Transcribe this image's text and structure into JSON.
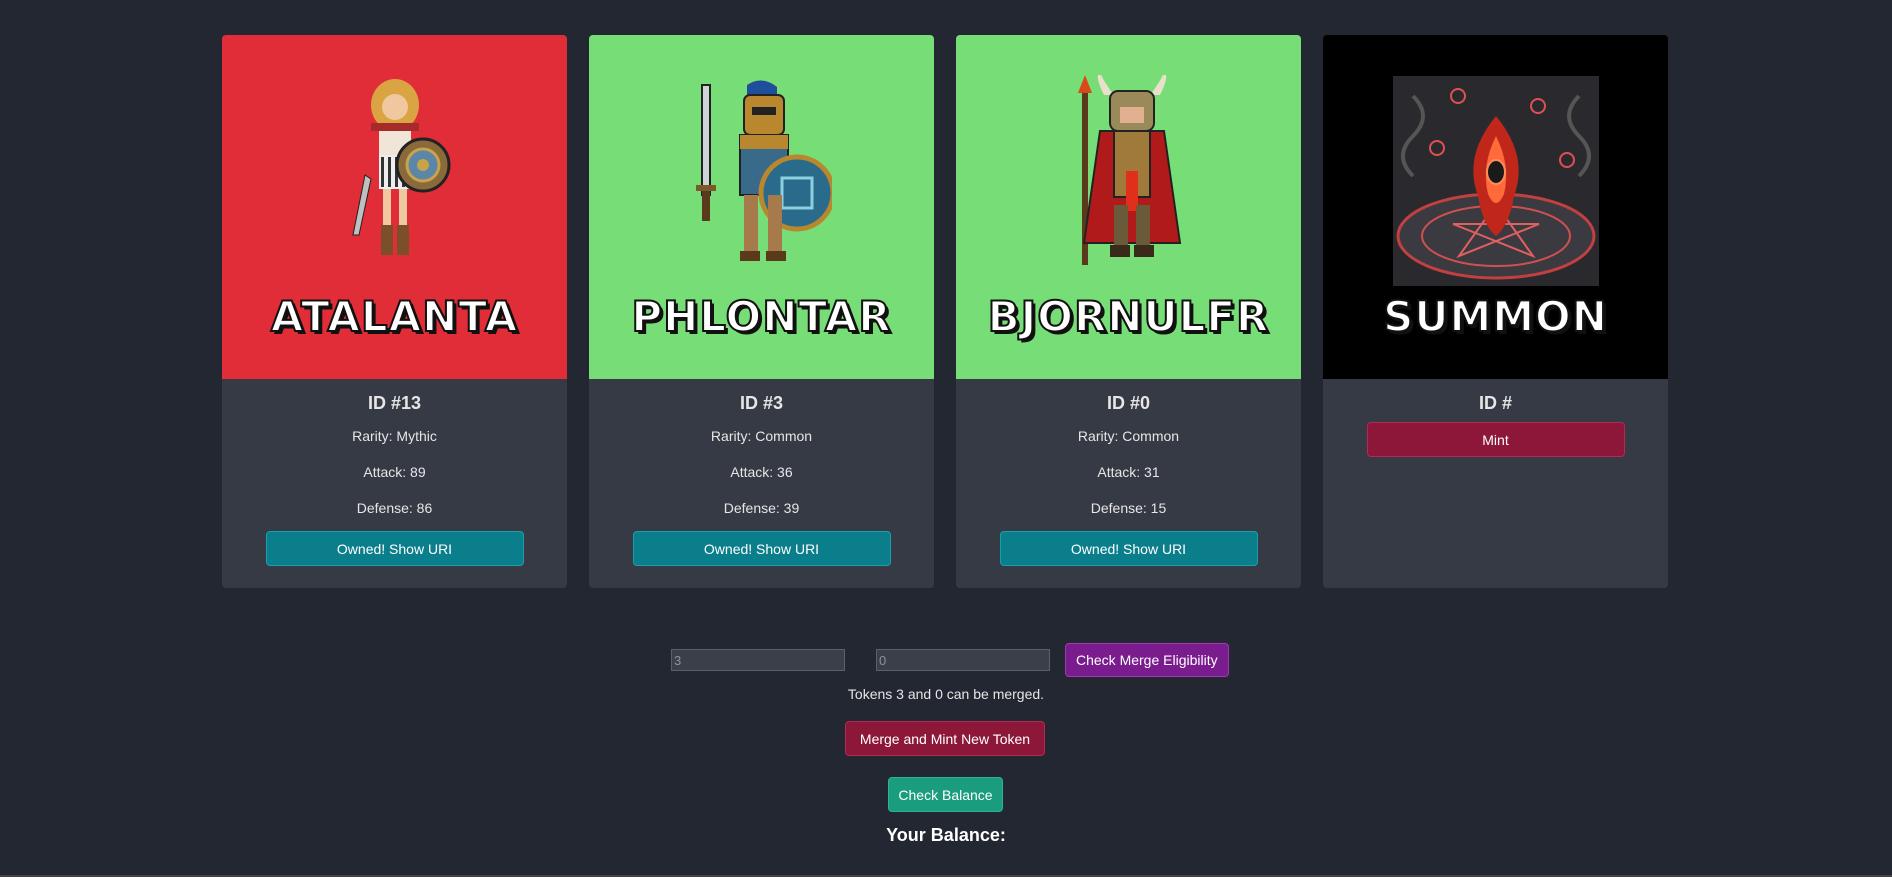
{
  "colors": {
    "background": "#222731",
    "card": "#363a44",
    "atalanta_bg": "#e02d38",
    "common_bg": "#77dd77",
    "summon_bg": "#000000",
    "owned_button": "#0a7e8b",
    "mint_button": "#8c1739",
    "merge_check_button": "#7a1b8e",
    "balance_button": "#1a9c7e"
  },
  "cards": [
    {
      "art_name": "ATALANTA",
      "id_text": "ID #13",
      "rarity": "Rarity: Mythic",
      "attack": "Attack: 89",
      "defense": "Defense: 86",
      "button": "Owned! Show URI"
    },
    {
      "art_name": "PHLONTAR",
      "id_text": "ID #3",
      "rarity": "Rarity: Common",
      "attack": "Attack: 36",
      "defense": "Defense: 39",
      "button": "Owned! Show URI"
    },
    {
      "art_name": "BJORNULFR",
      "id_text": "ID #0",
      "rarity": "Rarity: Common",
      "attack": "Attack: 31",
      "defense": "Defense: 15",
      "button": "Owned! Show URI"
    },
    {
      "art_name": "SUMMON",
      "id_text": "ID #",
      "button": "Mint"
    }
  ],
  "merge": {
    "token_a_value": "3",
    "token_b_value": "0",
    "check_button": "Check Merge Eligibility",
    "message": "Tokens 3 and 0 can be merged.",
    "mint_button": "Merge and Mint New Token"
  },
  "balance": {
    "button": "Check Balance",
    "label": "Your Balance:"
  }
}
